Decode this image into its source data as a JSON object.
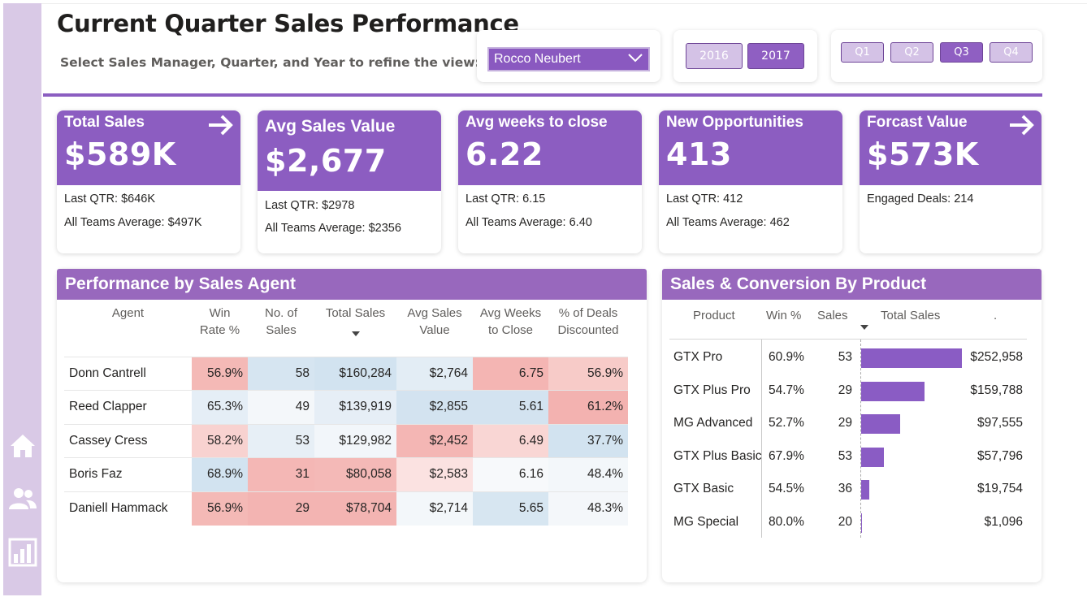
{
  "header": {
    "title": "Current Quarter Sales Performance",
    "subtitle": "Select Sales Manager, Quarter, and Year to refine the view:"
  },
  "filters": {
    "manager": "Rocco Neubert",
    "years": [
      {
        "label": "2016",
        "selected": false
      },
      {
        "label": "2017",
        "selected": true
      }
    ],
    "quarters": [
      {
        "label": "Q1",
        "selected": false
      },
      {
        "label": "Q2",
        "selected": false
      },
      {
        "label": "Q3",
        "selected": true
      },
      {
        "label": "Q4",
        "selected": false
      }
    ]
  },
  "nav": [
    "home-icon",
    "team-icon",
    "report-icon"
  ],
  "colors": {
    "accent": "#8c5dc1",
    "panel_header": "#9868bd",
    "rail": "#d9c9e6",
    "heat_red": "#f2b5b3",
    "heat_blue": "#cfe2f0"
  },
  "kpis": {
    "total_sales": {
      "label": "Total Sales",
      "value": "$589K",
      "line1": "Last QTR: $646K",
      "line2": "All Teams Average: $497K"
    },
    "avg_sales_value": {
      "label": "Avg Sales Value",
      "value": "$2,677",
      "line1": "Last QTR: $2978",
      "line2": "All Teams Average: $2356"
    },
    "avg_weeks": {
      "label": "Avg weeks to close",
      "value": "6.22",
      "line1": "Last QTR: 6.15",
      "line2": "All Teams Average: 6.40"
    },
    "new_opps": {
      "label": "New Opportunities",
      "value": "413",
      "line1": "Last QTR: 412",
      "line2": "All Teams Average: 462"
    },
    "forecast": {
      "label": "Forcast Value",
      "value": "$573K",
      "line1": "Engaged Deals: 214"
    }
  },
  "agents_panel": {
    "title": "Performance by Sales Agent",
    "columns": {
      "agent": "Agent",
      "win_rate_1": "Win",
      "win_rate_2": "Rate %",
      "num_sales_1": "No. of",
      "num_sales_2": "Sales",
      "total_sales": "Total Sales",
      "avg_value_1": "Avg Sales",
      "avg_value_2": "Value",
      "avg_weeks_1": "Avg Weeks",
      "avg_weeks_2": "to Close",
      "discounted_1": "% of Deals",
      "discounted_2": "Discounted"
    },
    "rows": [
      {
        "agent": "Donn Cantrell",
        "win_rate": "56.9%",
        "num_sales": "58",
        "total_sales": "$160,284",
        "avg_value": "$2,764",
        "avg_weeks": "6.75",
        "discounted": "56.9%"
      },
      {
        "agent": "Reed Clapper",
        "win_rate": "65.3%",
        "num_sales": "49",
        "total_sales": "$139,919",
        "avg_value": "$2,855",
        "avg_weeks": "5.61",
        "discounted": "61.2%"
      },
      {
        "agent": "Cassey Cress",
        "win_rate": "58.2%",
        "num_sales": "53",
        "total_sales": "$129,982",
        "avg_value": "$2,452",
        "avg_weeks": "6.49",
        "discounted": "37.7%"
      },
      {
        "agent": "Boris Faz",
        "win_rate": "68.9%",
        "num_sales": "31",
        "total_sales": "$80,058",
        "avg_value": "$2,583",
        "avg_weeks": "6.16",
        "discounted": "48.4%"
      },
      {
        "agent": "Daniell Hammack",
        "win_rate": "56.9%",
        "num_sales": "29",
        "total_sales": "$78,704",
        "avg_value": "$2,714",
        "avg_weeks": "5.65",
        "discounted": "48.3%"
      }
    ]
  },
  "product_panel": {
    "title": "Sales & Conversion By Product",
    "columns": {
      "product": "Product",
      "win": "Win %",
      "sales": "Sales",
      "total": "Total Sales",
      "extra": "."
    },
    "rows": [
      {
        "product": "GTX Pro",
        "win": "60.9%",
        "sales": "53",
        "total": "$252,958",
        "value": 252958
      },
      {
        "product": "GTX Plus Pro",
        "win": "54.7%",
        "sales": "29",
        "total": "$159,788",
        "value": 159788
      },
      {
        "product": "MG Advanced",
        "win": "52.7%",
        "sales": "29",
        "total": "$97,555",
        "value": 97555
      },
      {
        "product": "GTX Plus Basic",
        "win": "67.9%",
        "sales": "53",
        "total": "$57,796",
        "value": 57796
      },
      {
        "product": "GTX Basic",
        "win": "54.5%",
        "sales": "36",
        "total": "$19,754",
        "value": 19754
      },
      {
        "product": "MG Special",
        "win": "80.0%",
        "sales": "20",
        "total": "$1,096",
        "value": 1096
      }
    ]
  }
}
